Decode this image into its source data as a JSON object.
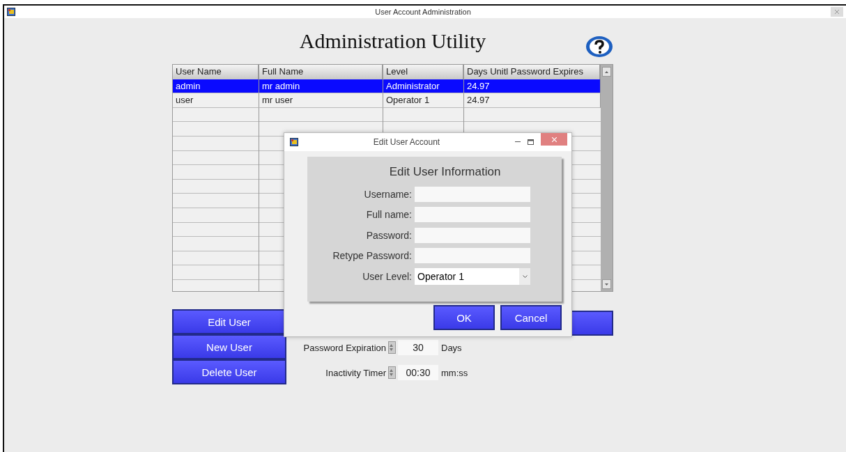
{
  "window": {
    "title": "User Account Administration"
  },
  "heading": "Administration Utility",
  "table": {
    "columns": [
      "User Name",
      "Full Name",
      "Level",
      "Days Unitl Password Expires"
    ],
    "rows": [
      {
        "cells": [
          "admin",
          "mr admin",
          "Administrator",
          "24.97"
        ],
        "selected": true
      },
      {
        "cells": [
          "user",
          "mr user",
          "Operator 1",
          "24.97"
        ],
        "selected": false
      }
    ]
  },
  "buttons": [
    "Edit User",
    "New User",
    "Delete User"
  ],
  "settings": [
    {
      "label": "Password Expiration",
      "value": "30",
      "unit": "Days"
    },
    {
      "label": "Inactivity Timer",
      "value": "00:30",
      "unit": "mm:ss"
    }
  ],
  "dialog": {
    "title": "Edit User Account",
    "heading": "Edit User Information",
    "fields": [
      {
        "kind": "text",
        "label": "Username:"
      },
      {
        "kind": "text",
        "label": "Full name:"
      },
      {
        "kind": "text",
        "label": "Password:"
      },
      {
        "kind": "text",
        "label": "Retype Password:"
      },
      {
        "kind": "select",
        "label": "User Level:",
        "value": "Operator 1"
      }
    ],
    "buttons": [
      "OK",
      "Cancel"
    ]
  }
}
